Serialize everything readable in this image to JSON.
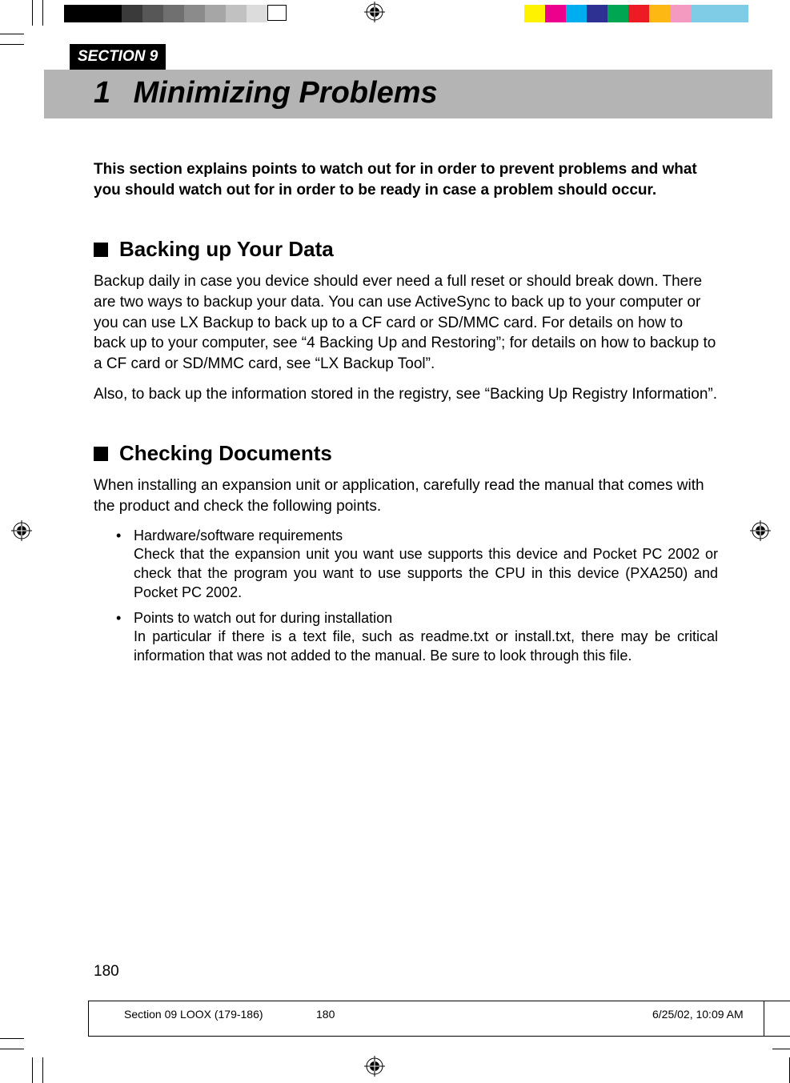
{
  "printbar": {
    "left_colors": [
      "#000000",
      "#3a3a3a",
      "#575757",
      "#707070",
      "#8b8b8b",
      "#a6a6a6",
      "#c1c1c1",
      "#dcdcdc",
      "#ffffff"
    ],
    "right_colors": [
      "#fff200",
      "#ec008c",
      "#00aeef",
      "#2e3192",
      "#00a651",
      "#ed1c24",
      "#fdb813",
      "#f49ac1",
      "#7ecce5"
    ],
    "left_has_border_on_last": true
  },
  "section": {
    "label": "SECTION 9",
    "chapter_number": "1",
    "chapter_title": "Minimizing Problems"
  },
  "intro": "This section explains points to watch out for in order to prevent problems and what you should watch out for in order to be ready in case a problem should occur.",
  "sub1": {
    "title": "Backing up Your Data",
    "p1": "Backup daily in case you device should ever need a full reset or should break down. There are two ways to backup your data. You can use ActiveSync to back up to your computer or you can use LX Backup to back up to a CF card or SD/MMC card. For details on how to back up to your computer, see “4 Backing Up and Restoring”; for details on how to backup to a CF card or SD/MMC card, see “LX Backup Tool”.",
    "p2": "Also, to back up the information stored in the registry, see “Backing Up Registry Information”."
  },
  "sub2": {
    "title": "Checking Documents",
    "p1": "When installing an expansion unit or application, carefully read the manual that comes with the product and check the following points.",
    "bullets": [
      {
        "title": "Hardware/software requirements",
        "body": "Check that the expansion unit you want use supports this device and Pocket PC 2002 or check that the program you want to use supports the CPU in this device (PXA250) and Pocket PC 2002."
      },
      {
        "title": "Points to watch out for during installation",
        "body": "In particular if there is a text file, such as readme.txt or install.txt, there may be critical information that was not added to the manual. Be sure to look through this file."
      }
    ]
  },
  "page_number": "180",
  "slug": {
    "file": "Section 09 LOOX (179-186)",
    "page": "180",
    "timestamp": "6/25/02, 10:09 AM"
  }
}
